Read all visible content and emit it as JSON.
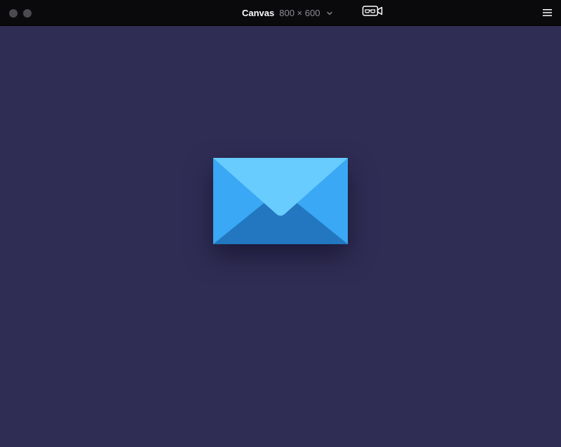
{
  "window": {
    "title": "Canvas",
    "size_label": "800 × 600"
  },
  "icons": {
    "close": "traffic-light-close",
    "minimize": "traffic-light-minimize",
    "dropdown": "chevron-down-icon",
    "camera": "vr-camera-icon",
    "menu": "hamburger-menu-icon",
    "content": "envelope-icon"
  },
  "colors": {
    "canvas_background": "#2f2d54",
    "titlebar_background": "#0a0a0c",
    "envelope_back": "#2e9df0",
    "envelope_front": "#2277c0",
    "envelope_flap": "#68ccff"
  }
}
